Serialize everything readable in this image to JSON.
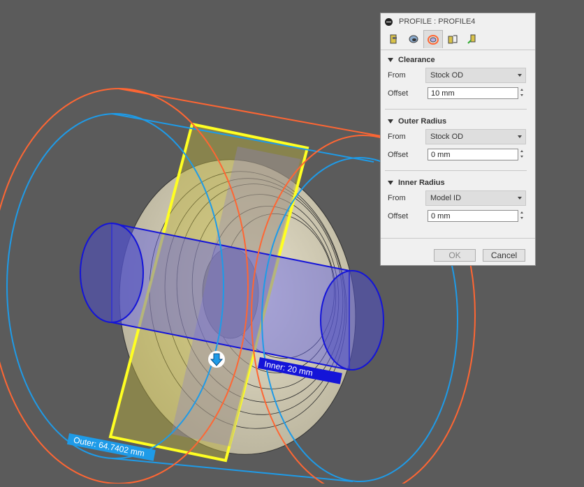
{
  "viewport": {
    "outer_label": "Outer: 64.7402 mm",
    "inner_label": "Inner: 20 mm",
    "icons": [
      "arrow-down-icon"
    ]
  },
  "panel": {
    "title": "PROFILE : PROFILE4",
    "tabs": [
      {
        "icon": "tool-tab-icon"
      },
      {
        "icon": "geometry-tab-icon"
      },
      {
        "icon": "radii-tab-icon",
        "active": true
      },
      {
        "icon": "passes-tab-icon"
      },
      {
        "icon": "linking-tab-icon"
      }
    ],
    "clearance": {
      "heading": "Clearance",
      "from_label": "From",
      "from_value": "Stock OD",
      "offset_label": "Offset",
      "offset_value": "10 mm"
    },
    "outer_radius": {
      "heading": "Outer Radius",
      "from_label": "From",
      "from_value": "Stock OD",
      "offset_label": "Offset",
      "offset_value": "0 mm"
    },
    "inner_radius": {
      "heading": "Inner Radius",
      "from_label": "From",
      "from_value": "Model ID",
      "offset_label": "Offset",
      "offset_value": "0 mm"
    },
    "ok_label": "OK",
    "cancel_label": "Cancel"
  },
  "colors": {
    "background": "#5b5b5b",
    "clearance_curve": "#ff6633",
    "outer_radius_curve": "#1e9be8",
    "inner_cylinder": "#1414d8",
    "profile_frame": "#ffff22"
  }
}
